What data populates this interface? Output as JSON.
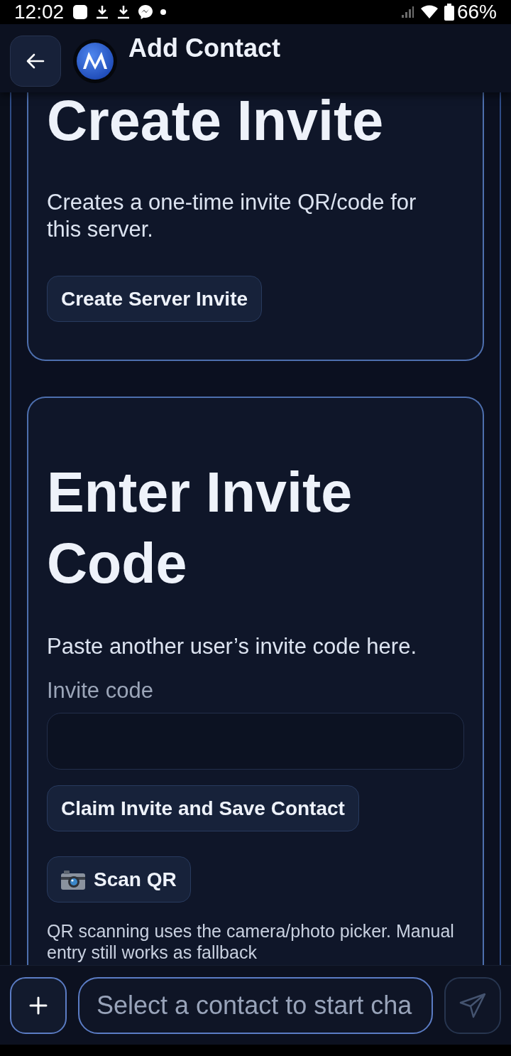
{
  "status_bar": {
    "time": "12:02",
    "battery": "66%"
  },
  "header": {
    "title": "Add Contact"
  },
  "cards": [
    {
      "title": "Create Invite",
      "description": "Creates a one-time invite QR/code for this server.",
      "buttons": [
        {
          "kind": "action",
          "label": "Create Server Invite"
        }
      ]
    },
    {
      "title": "Enter Invite Code",
      "description": "Paste another user’s invite code here.",
      "field": {
        "label": "Invite code"
      },
      "buttons": [
        {
          "kind": "action",
          "label": "Claim Invite and Save Contact"
        },
        {
          "kind": "scan",
          "label": "Scan QR"
        }
      ],
      "note": "QR scanning uses the camera/photo picker. Manual entry still works as fallback"
    }
  ],
  "composer": {
    "placeholder": "Select a contact to start cha",
    "send_disabled": true
  }
}
